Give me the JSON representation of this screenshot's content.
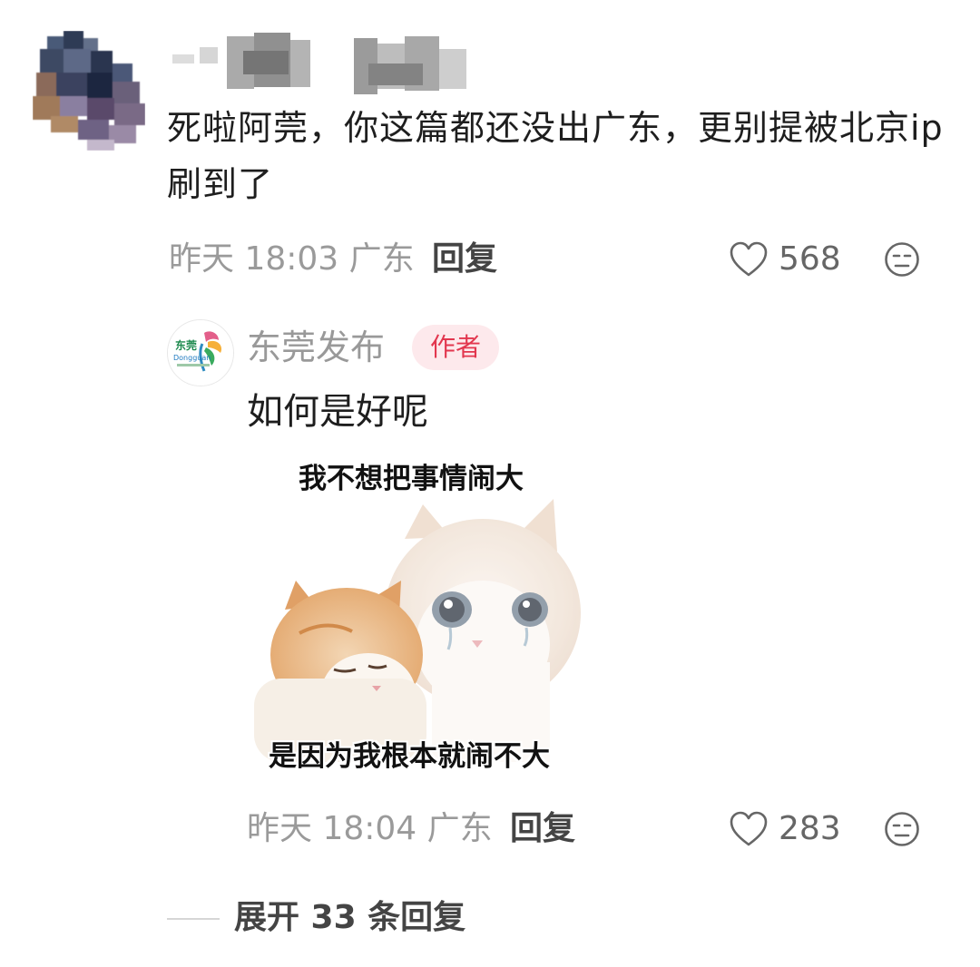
{
  "top_comment": {
    "text": "死啦阿莞，你这篇都还没出广东，更别提被北京ip刷到了",
    "time": "昨天 18:03",
    "location": "广东",
    "reply_label": "回复",
    "likes": "568"
  },
  "reply": {
    "author": "东莞发布",
    "avatar_text": "东莞",
    "avatar_subtext": "Dongguan",
    "badge": "作者",
    "text": "如何是好呢",
    "meme": {
      "top_caption": "我不想把事情闹大",
      "bottom_caption": "是因为我根本就闹不大"
    },
    "time": "昨天 18:04",
    "location": "广东",
    "reply_label": "回复",
    "likes": "283"
  },
  "expand": {
    "label": "展开 33 条回复"
  },
  "colors": {
    "badge_bg": "#fde9ec",
    "badge_text": "#e2364e",
    "meta_gray": "#9a9a9a"
  }
}
